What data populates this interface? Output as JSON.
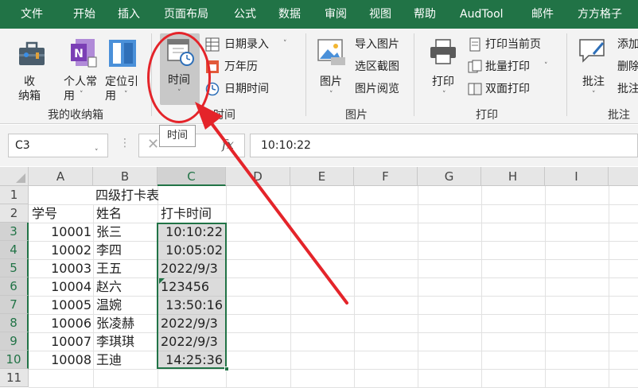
{
  "tabs": [
    "文件",
    "开始",
    "插入",
    "页面布局",
    "公式",
    "数据",
    "审阅",
    "视图",
    "帮助",
    "AudTool",
    "邮件",
    "方方格子"
  ],
  "ribbon": {
    "collect_label": "收\n纳箱",
    "personal_label": "个人常\n用",
    "locate_label": "定位引\n用",
    "group_my_box": "我的收纳箱",
    "time_label": "时间",
    "date_entry": "日期录入",
    "calendar": "万年历",
    "date_time": "日期时间",
    "group_time": "时间",
    "picture_label": "图片",
    "import_pic": "导入图片",
    "screenshot": "选区截图",
    "pic_browse": "图片阅览",
    "group_picture": "图片",
    "print_label": "打印",
    "print_current": "打印当前页",
    "batch_print": "批量打印",
    "duplex_print": "双面打印",
    "group_print": "打印",
    "comment_label": "批注",
    "add": "添加",
    "delete": "删除",
    "comment_partial": "批注",
    "group_comment": "批注"
  },
  "tooltip": "时间",
  "formula_bar": {
    "name_box": "C3",
    "fx": "fx",
    "formula": "10:10:22"
  },
  "columns": [
    "A",
    "B",
    "C",
    "D",
    "E",
    "F",
    "G",
    "H",
    "I"
  ],
  "rows": [
    "1",
    "2",
    "3",
    "4",
    "5",
    "6",
    "7",
    "8",
    "9",
    "10",
    "11"
  ],
  "sheet": {
    "title": "四级打卡表",
    "headers": [
      "学号",
      "姓名",
      "打卡时间"
    ],
    "data": [
      {
        "id": "10001",
        "name": "张三",
        "time": "10:10:22"
      },
      {
        "id": "10002",
        "name": "李四",
        "time": "10:05:02"
      },
      {
        "id": "10003",
        "name": "王五",
        "time": "2022/9/3"
      },
      {
        "id": "10004",
        "name": "赵六",
        "time": "123456"
      },
      {
        "id": "10005",
        "name": "温婉",
        "time": "13:50:16"
      },
      {
        "id": "10006",
        "name": "张凌赫",
        "time": "2022/9/3"
      },
      {
        "id": "10007",
        "name": "李琪琪",
        "time": "2022/9/3"
      },
      {
        "id": "10008",
        "name": "王迪",
        "time": "14:25:36"
      }
    ]
  },
  "colors": {
    "excel_green": "#217346",
    "annotation_red": "#e4242a"
  }
}
